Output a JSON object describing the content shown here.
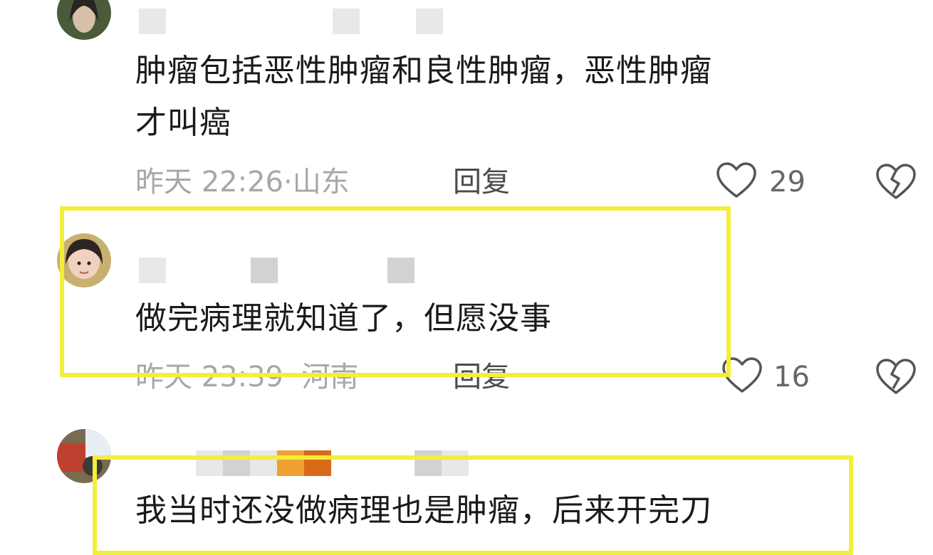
{
  "comments": [
    {
      "text_line1": "肿瘤包括恶性肿瘤和良性肿瘤，恶性肿瘤",
      "text_line2": "才叫癌",
      "time": "昨天 22:26",
      "location": "山东",
      "reply": "回复",
      "likes": "29"
    },
    {
      "text_line1": "做完病理就知道了，但愿没事",
      "time": "昨天 23:39",
      "location": "河南",
      "reply": "回复",
      "likes": "16"
    },
    {
      "text_line1": "我当时还没做病理也是肿瘤，后来开完刀"
    }
  ],
  "colors": {
    "highlight": "#f3ee3a",
    "meta": "#a7a7ab",
    "text": "#1a1a1a"
  },
  "icons": {
    "like": "heart-outline-icon",
    "dislike": "broken-heart-icon"
  }
}
